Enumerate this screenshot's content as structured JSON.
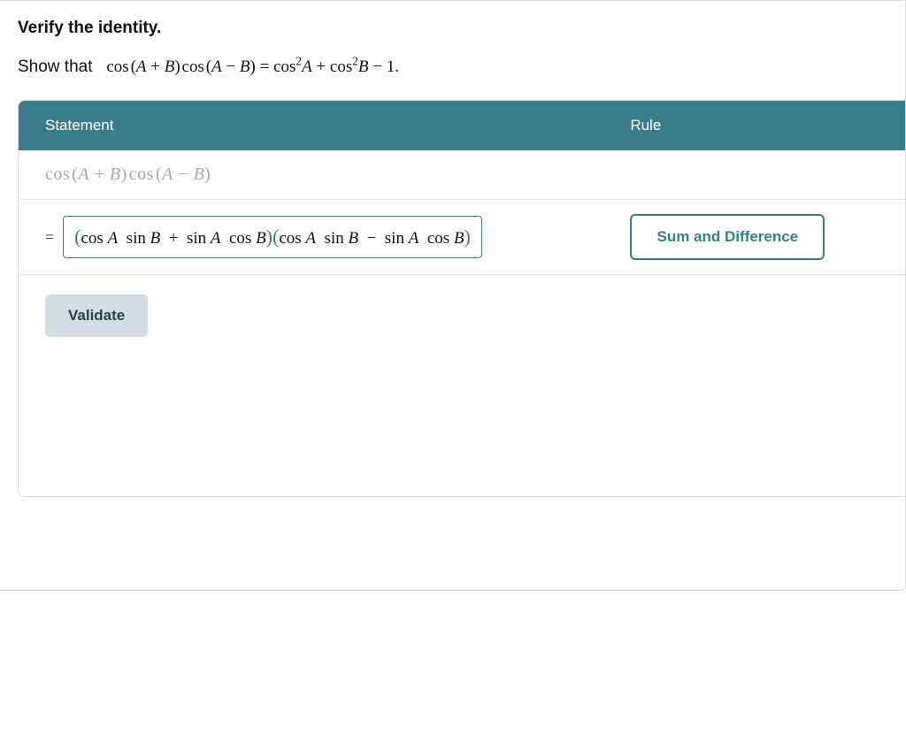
{
  "instruction": {
    "title": "Verify the identity.",
    "prefix": "Show that",
    "equation_html": "cos (A + B) cos (A − B) = cos²A + cos²B − 1."
  },
  "table": {
    "header_statement": "Statement",
    "header_rule": "Rule",
    "given": "cos (A + B) cos (A − B)"
  },
  "step": {
    "equals": "=",
    "expression": "(cos A sin B + sin A cos B)(cos A sin B − sin A cos B)",
    "rule_label": "Sum and Difference"
  },
  "validate_label": "Validate"
}
